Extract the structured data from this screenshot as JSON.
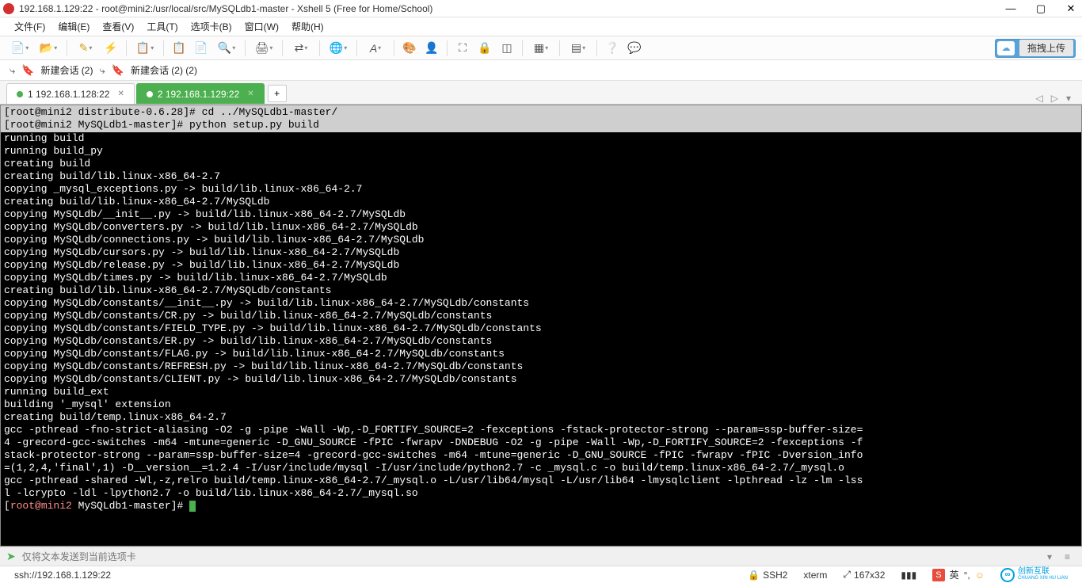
{
  "titlebar": {
    "title": "192.168.1.129:22 - root@mini2:/usr/local/src/MySQLdb1-master - Xshell 5 (Free for Home/School)",
    "min": "—",
    "max": "▢",
    "close": "✕"
  },
  "menu": {
    "file": "文件(F)",
    "edit": "编辑(E)",
    "view": "查看(V)",
    "tools": "工具(T)",
    "tab": "选项卡(B)",
    "window": "窗口(W)",
    "help": "帮助(H)"
  },
  "toolbar": {
    "upload_label": "拖拽上传"
  },
  "sessionbar": {
    "new1": "新建会话  (2)",
    "new2": "新建会话  (2)  (2)"
  },
  "tabs": {
    "t1": "1 192.168.1.128:22",
    "t2": "2 192.168.1.129:22",
    "add": "+"
  },
  "terminal": {
    "header1": "[root@mini2 distribute-0.6.28]# cd ../MySQLdb1-master/",
    "header2": "[root@mini2 MySQLdb1-master]# python setup.py build",
    "lines": [
      "running build",
      "running build_py",
      "creating build",
      "creating build/lib.linux-x86_64-2.7",
      "copying _mysql_exceptions.py -> build/lib.linux-x86_64-2.7",
      "creating build/lib.linux-x86_64-2.7/MySQLdb",
      "copying MySQLdb/__init__.py -> build/lib.linux-x86_64-2.7/MySQLdb",
      "copying MySQLdb/converters.py -> build/lib.linux-x86_64-2.7/MySQLdb",
      "copying MySQLdb/connections.py -> build/lib.linux-x86_64-2.7/MySQLdb",
      "copying MySQLdb/cursors.py -> build/lib.linux-x86_64-2.7/MySQLdb",
      "copying MySQLdb/release.py -> build/lib.linux-x86_64-2.7/MySQLdb",
      "copying MySQLdb/times.py -> build/lib.linux-x86_64-2.7/MySQLdb",
      "creating build/lib.linux-x86_64-2.7/MySQLdb/constants",
      "copying MySQLdb/constants/__init__.py -> build/lib.linux-x86_64-2.7/MySQLdb/constants",
      "copying MySQLdb/constants/CR.py -> build/lib.linux-x86_64-2.7/MySQLdb/constants",
      "copying MySQLdb/constants/FIELD_TYPE.py -> build/lib.linux-x86_64-2.7/MySQLdb/constants",
      "copying MySQLdb/constants/ER.py -> build/lib.linux-x86_64-2.7/MySQLdb/constants",
      "copying MySQLdb/constants/FLAG.py -> build/lib.linux-x86_64-2.7/MySQLdb/constants",
      "copying MySQLdb/constants/REFRESH.py -> build/lib.linux-x86_64-2.7/MySQLdb/constants",
      "copying MySQLdb/constants/CLIENT.py -> build/lib.linux-x86_64-2.7/MySQLdb/constants",
      "running build_ext",
      "building '_mysql' extension",
      "creating build/temp.linux-x86_64-2.7",
      "gcc -pthread -fno-strict-aliasing -O2 -g -pipe -Wall -Wp,-D_FORTIFY_SOURCE=2 -fexceptions -fstack-protector-strong --param=ssp-buffer-size=",
      "4 -grecord-gcc-switches -m64 -mtune=generic -D_GNU_SOURCE -fPIC -fwrapv -DNDEBUG -O2 -g -pipe -Wall -Wp,-D_FORTIFY_SOURCE=2 -fexceptions -f",
      "stack-protector-strong --param=ssp-buffer-size=4 -grecord-gcc-switches -m64 -mtune=generic -D_GNU_SOURCE -fPIC -fwrapv -fPIC -Dversion_info",
      "=(1,2,4,'final',1) -D__version__=1.2.4 -I/usr/include/mysql -I/usr/include/python2.7 -c _mysql.c -o build/temp.linux-x86_64-2.7/_mysql.o",
      "gcc -pthread -shared -Wl,-z,relro build/temp.linux-x86_64-2.7/_mysql.o -L/usr/lib64/mysql -L/usr/lib64 -lmysqlclient -lpthread -lz -lm -lss",
      "l -lcrypto -ldl -lpython2.7 -o build/lib.linux-x86_64-2.7/_mysql.so"
    ],
    "prompt_bracket_open": "[",
    "prompt_user": "root@mini2",
    "prompt_path": " MySQLdb1-master",
    "prompt_bracket_close": "]# "
  },
  "inputbar": {
    "placeholder": "仅将文本发送到当前选项卡"
  },
  "statusbar": {
    "conn": "ssh://192.168.1.129:22",
    "ssh": "SSH2",
    "term": "xterm",
    "size": "167x32",
    "lang": "英",
    "ime": "S",
    "brand_cn": "创新互联",
    "brand_en": "CHUANG XIN HU LIAN"
  }
}
